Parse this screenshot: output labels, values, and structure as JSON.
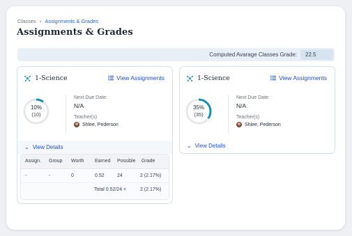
{
  "breadcrumb": {
    "root": "Classes",
    "current": "Assignments & Grades"
  },
  "page_title": "Assignments & Grades",
  "computed": {
    "label": "Computed Avarage Classes Grade:",
    "value": "22.5"
  },
  "colors": {
    "accent": "#1d4ed8",
    "ring": "#1a8fb6",
    "card_border": "#cfe3ec"
  },
  "cards": [
    {
      "subject": "1-Science",
      "view_assignments": "View Assignments",
      "progress_label": "10%",
      "progress_sub": "(10)",
      "progress_fraction": 0.1,
      "next_due_label": "Next Due Date:",
      "next_due_value": "N/A",
      "teacher_label": "Teacher(s)",
      "teacher_name": "Shlee, Pederson",
      "view_details": "View Details",
      "table": {
        "headers": [
          "Assign.",
          "Group",
          "Worth",
          "Earned",
          "Possible",
          "Grade"
        ],
        "rows": [
          [
            "-",
            "-",
            "0",
            "0.52",
            "24",
            "2 (2.17%)"
          ]
        ],
        "total_label": "Total 0.52/24 =",
        "total_value": "2 (2.17%)"
      }
    },
    {
      "subject": "1-Science",
      "view_assignments": "View Assignments",
      "progress_label": "35%",
      "progress_sub": "(35)",
      "progress_fraction": 0.35,
      "next_due_label": "Next Due Date:",
      "next_due_value": "N/A",
      "teacher_label": "Teacher(s)",
      "teacher_name": "Shlee, Pederson",
      "view_details": "View Details"
    }
  ]
}
